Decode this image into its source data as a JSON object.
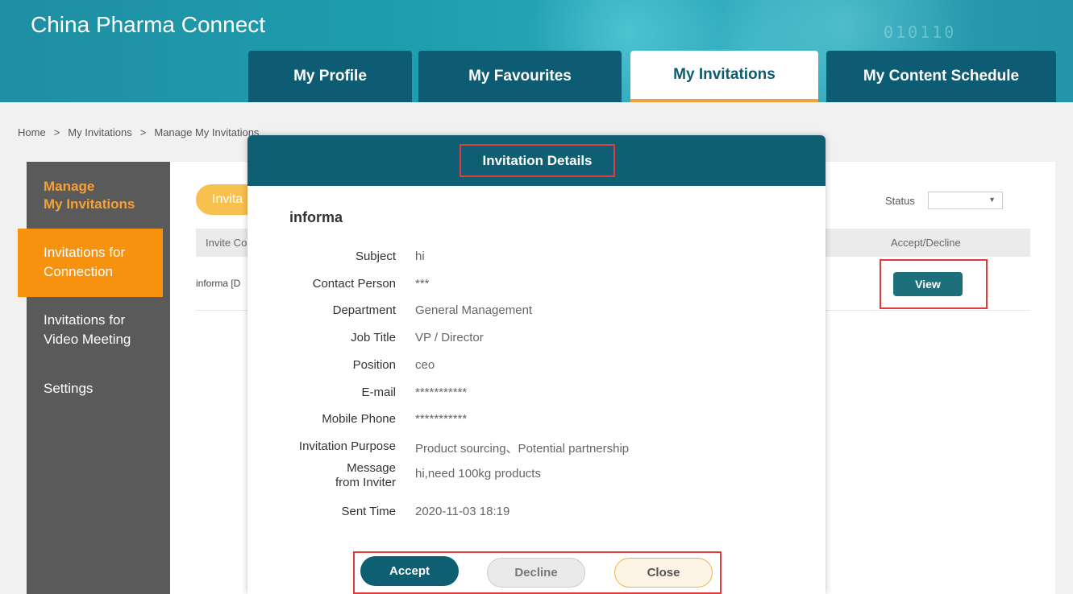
{
  "header": {
    "site_title": "China Pharma Connect",
    "deco_text": "010110",
    "tabs": [
      {
        "label": "My Profile",
        "active": false
      },
      {
        "label": "My Favourites",
        "active": false
      },
      {
        "label": "My Invitations",
        "active": true
      },
      {
        "label": "My Content Schedule",
        "active": false
      }
    ]
  },
  "breadcrumb": [
    "Home",
    ">",
    "My Invitations",
    ">",
    "Manage My Invitations"
  ],
  "sidebar": {
    "heading_line1": "Manage",
    "heading_line2": "My Invitations",
    "items": [
      {
        "line1": "Invitations for",
        "line2": "Connection",
        "active": true
      },
      {
        "line1": "Invitations for",
        "line2": "Video Meeting",
        "active": false
      },
      {
        "line1": "Settings",
        "line2": "",
        "active": false
      }
    ]
  },
  "main": {
    "pill_label": "Invita",
    "status_label": "Status",
    "status_value": "",
    "table": {
      "col_first": "Invite Co",
      "col_accept": "Accept/Decline",
      "row_first": "informa [D",
      "view_label": "View"
    }
  },
  "modal": {
    "title": "Invitation Details",
    "name": "informa",
    "fields": [
      {
        "label": "Subject",
        "value": "hi"
      },
      {
        "label": "Contact Person",
        "value": "***"
      },
      {
        "label": "Department",
        "value": "General Management"
      },
      {
        "label": "Job Title",
        "value": "VP / Director"
      },
      {
        "label": "Position",
        "value": "ceo"
      },
      {
        "label": "E-mail",
        "value": "***********"
      },
      {
        "label": "Mobile Phone",
        "value": "***********"
      },
      {
        "label": "Invitation Purpose",
        "value": "Product sourcing、Potential partnership"
      },
      {
        "label": "Message from Inviter",
        "label_line1": "Message",
        "label_line2": "from Inviter",
        "value": "hi,need 100kg products"
      },
      {
        "label": "Sent Time",
        "value": "2020-11-03 18:19"
      }
    ],
    "buttons": {
      "accept": "Accept",
      "decline": "Decline",
      "close": "Close"
    }
  },
  "colors": {
    "teal": "#0f5f73",
    "orange": "#f6920d",
    "highlight": "#e03c3c",
    "sidebar": "#5a5a5a"
  }
}
